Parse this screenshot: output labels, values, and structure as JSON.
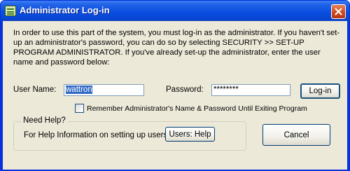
{
  "window": {
    "title": "Administrator Log-in",
    "title_icon": "window-app-icon",
    "close_icon": "close-icon"
  },
  "description": "In order to use this part of the system, you must log-in as the administrator.  If you haven't set-up an administrator's password, you can do so by selecting SECURITY >> SET-UP PROGRAM ADMINISTRATOR.  If you've already set-up the administrator, enter the user name and password below:",
  "form": {
    "username_label": "User Name:",
    "username_value": "wattron",
    "password_label": "Password:",
    "password_value": "********",
    "login_label": "Log-in",
    "remember_label": "Remember Administrator's Name & Password Until Exiting Program",
    "remember_checked": false
  },
  "help": {
    "legend": "Need Help?",
    "text": "For Help Information on setting up users:",
    "button_label": "Users: Help"
  },
  "cancel_label": "Cancel",
  "colors": {
    "titlebar": "#0a4fe0",
    "client": "#ece9d8",
    "selection": "#316ac5",
    "close_button": "#d24a1c"
  }
}
